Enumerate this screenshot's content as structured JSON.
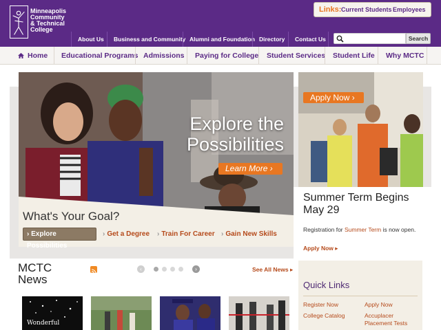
{
  "brand": {
    "name_lines": [
      "Minneapolis",
      "Community",
      "& Technical",
      "College"
    ]
  },
  "toplinks": {
    "label": "Links:",
    "items": [
      "Current Students",
      "Employees"
    ]
  },
  "utility_nav": [
    "About Us",
    "Business and Community",
    "Alumni and Foundation",
    "Directory",
    "Contact Us"
  ],
  "search": {
    "placeholder": "",
    "button_label": "Search"
  },
  "main_nav": [
    "Home",
    "Educational Programs",
    "Admissions",
    "Paying for College",
    "Student Services",
    "Student Life",
    "Why MCTC"
  ],
  "hero": {
    "title_lines": [
      "Explore the",
      "Possibilities"
    ],
    "button_label": "Learn More ›"
  },
  "goal": {
    "title": "What's Your Goal?",
    "active_tab": "Explore Possibilities",
    "tabs": [
      "Get a Degree",
      "Train For Career",
      "Gain New Skills"
    ]
  },
  "promo": {
    "button_label": "Apply Now ›",
    "title": "Summer Term Begins May 29",
    "body_prefix": "Registration for ",
    "body_highlight": "Summer Term",
    "body_suffix": " is now open.",
    "link_label": "Apply Now ▸"
  },
  "news": {
    "title": "MCTC News",
    "see_all": "See All News ▸",
    "pager_prev": "‹",
    "pager_next": "›",
    "thumb_caption": "Wonderful"
  },
  "quick_links": {
    "title": "Quick Links",
    "col1": [
      "Register Now",
      "College Catalog"
    ],
    "col2": [
      "Apply Now",
      "Accuplacer Placement Tests"
    ]
  },
  "colors": {
    "purple": "#5b2a86",
    "orange": "#e87722",
    "rust": "#b54a1b",
    "cream": "#f3efe6"
  }
}
